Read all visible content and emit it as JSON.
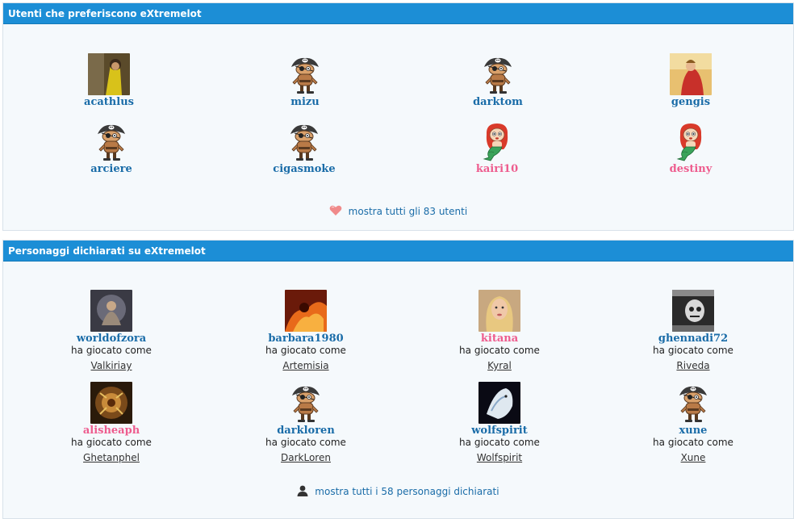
{
  "fans": {
    "title": "Utenti che preferiscono eXtremelot",
    "users": [
      {
        "name": "acathlus",
        "avatar": "photo-icon",
        "gender": "m"
      },
      {
        "name": "mizu",
        "avatar": "pirate-icon",
        "gender": "m"
      },
      {
        "name": "darktom",
        "avatar": "pirate-icon",
        "gender": "m"
      },
      {
        "name": "gengis",
        "avatar": "photo-icon",
        "gender": "m"
      },
      {
        "name": "arciere",
        "avatar": "pirate-icon",
        "gender": "m"
      },
      {
        "name": "cigasmoke",
        "avatar": "pirate-icon",
        "gender": "m"
      },
      {
        "name": "kairi10",
        "avatar": "mermaid-icon",
        "gender": "f"
      },
      {
        "name": "destiny",
        "avatar": "mermaid-icon",
        "gender": "f"
      }
    ],
    "more_label": "mostra tutti gli 83 utenti",
    "more_icon": "heart-icon"
  },
  "characters": {
    "title": "Personaggi dichiarati su eXtremelot",
    "played_as": "ha giocato come",
    "users": [
      {
        "name": "worldofzora",
        "character": "Valkiriay",
        "gender": "m"
      },
      {
        "name": "barbara1980",
        "character": "Artemisia",
        "gender": "m"
      },
      {
        "name": "kitana",
        "character": "Kyral",
        "gender": "f"
      },
      {
        "name": "ghennadi72",
        "character": "Riveda",
        "gender": "m"
      },
      {
        "name": "alisheaph",
        "character": "Ghetanphel",
        "gender": "f"
      },
      {
        "name": "darkloren",
        "character": "DarkLoren",
        "gender": "m"
      },
      {
        "name": "wolfspirit",
        "character": "Wolfspirit",
        "gender": "m"
      },
      {
        "name": "xune",
        "character": "Xune",
        "gender": "m"
      }
    ],
    "more_label": "mostra tutti i 58 personaggi dichiarati",
    "more_icon": "user-icon"
  },
  "colors": {
    "header_bg": "#1c8ed6",
    "male_name": "#1a6ca8",
    "female_name": "#ee5c8e"
  }
}
